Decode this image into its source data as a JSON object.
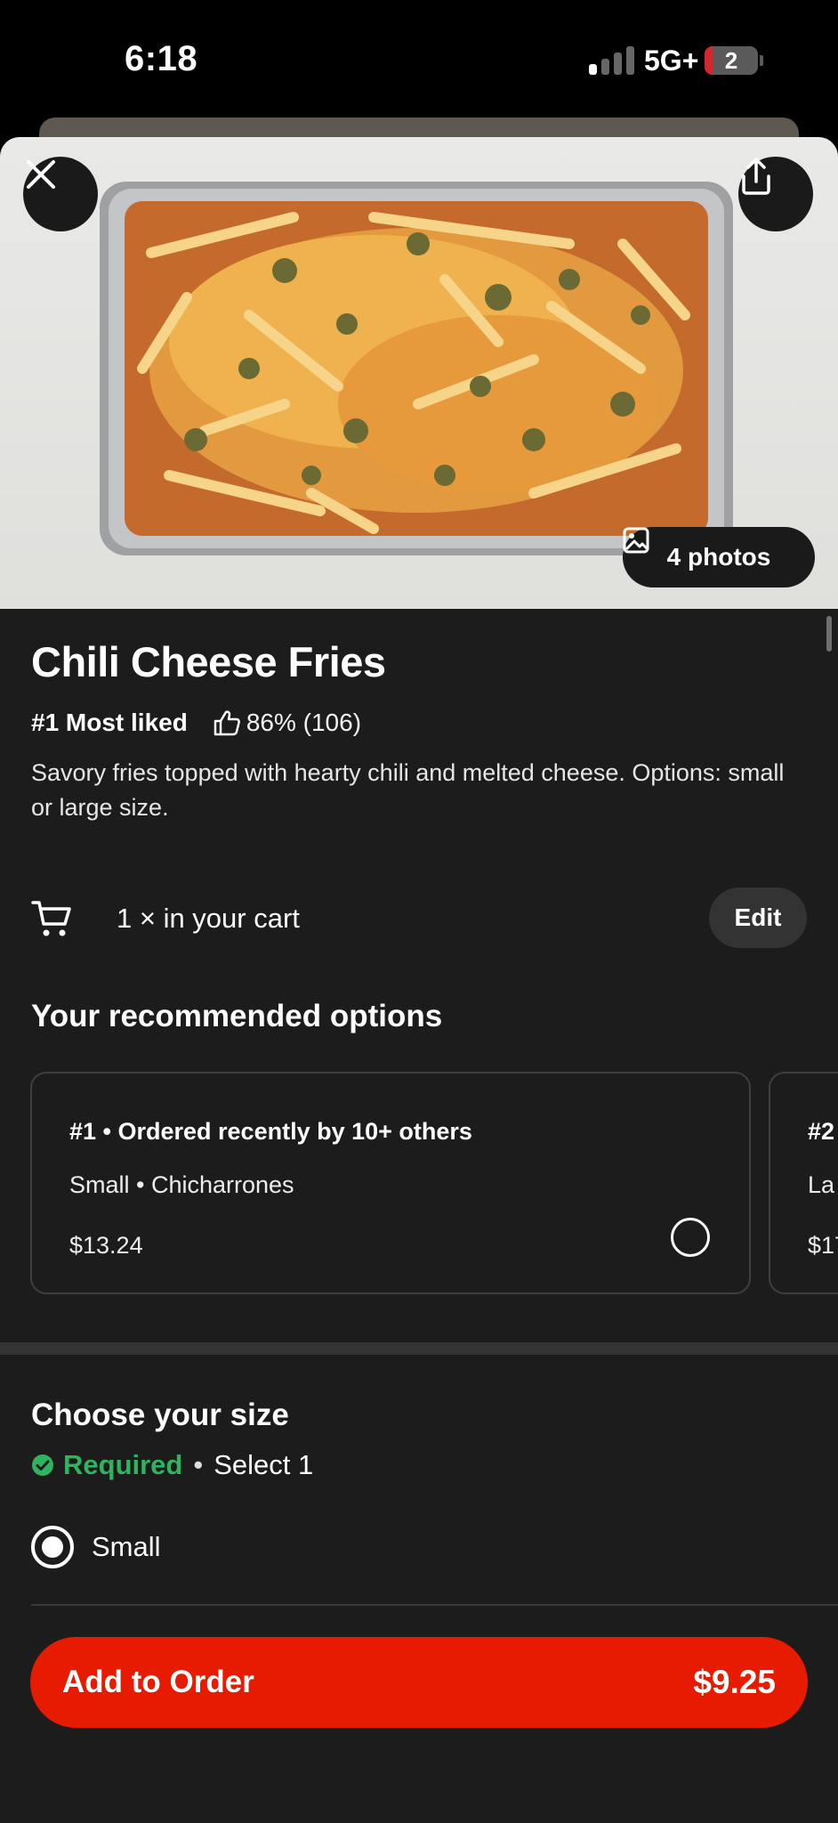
{
  "status_bar": {
    "time": "6:18",
    "network": "5G+",
    "battery_level": "2",
    "battery_fraction": 0.02,
    "signal_bars_active": 1,
    "signal_bars_total": 4
  },
  "hero": {
    "photos_label": "4 photos",
    "close_icon": "close-icon",
    "share_icon": "share-icon",
    "photos_icon": "image-icon"
  },
  "item": {
    "title": "Chili Cheese Fries",
    "rank": "#1 Most liked",
    "rating": "86% (106)",
    "rating_icon": "thumbs-up-icon",
    "description": "Savory fries topped with hearty chili and melted cheese. Options: small or large size."
  },
  "cart": {
    "icon": "cart-icon",
    "text": "1 × in your cart",
    "edit_label": "Edit"
  },
  "recommended": {
    "title": "Your recommended options",
    "cards": [
      {
        "heading": "#1 • Ordered recently by 10+ others",
        "options": "Small • Chicharrones",
        "price": "$13.24",
        "selected": false
      },
      {
        "heading": "#2",
        "options": "La",
        "price": "$17",
        "selected": false
      }
    ]
  },
  "size_section": {
    "title": "Choose your size",
    "required_label": "Required",
    "required_icon": "check-circle-icon",
    "select_hint": "Select 1",
    "separator": "•",
    "options": [
      {
        "label": "Small",
        "selected": true
      }
    ]
  },
  "order": {
    "add_label": "Add to Order",
    "price": "$9.25"
  },
  "colors": {
    "accent": "#e61b00",
    "required_green": "#30b35e",
    "surface": "#1c1c1c"
  }
}
